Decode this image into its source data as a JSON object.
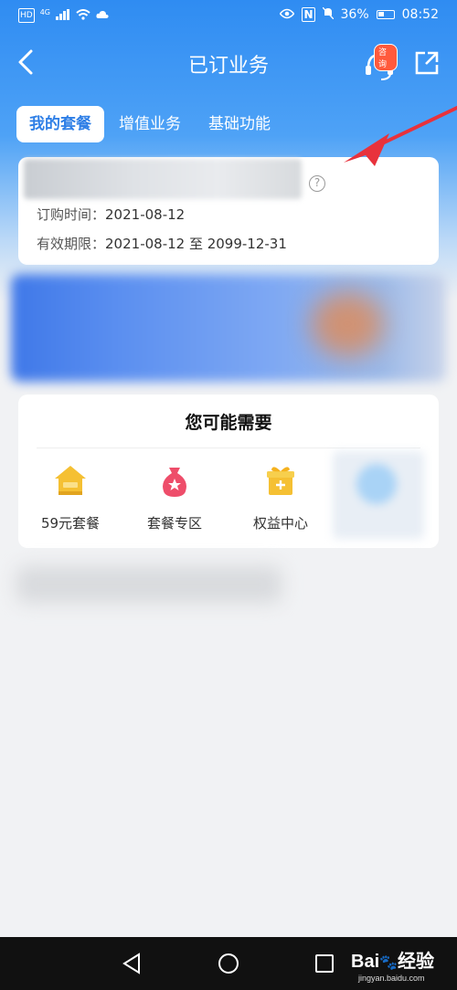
{
  "status_bar": {
    "network_left": "HD",
    "network_sup": "4G",
    "battery_percent": "36%",
    "time": "08:52",
    "battery_level": 0.36
  },
  "header": {
    "title": "已订业务",
    "service_badge": "咨询"
  },
  "tabs": [
    {
      "label": "我的套餐",
      "active": true
    },
    {
      "label": "增值业务",
      "active": false
    },
    {
      "label": "基础功能",
      "active": false
    }
  ],
  "package": {
    "order_time_label": "订购时间：",
    "order_time_value": "2021-08-12",
    "valid_label": "有效期限：",
    "valid_value": "2021-08-12 至 2099-12-31"
  },
  "need_section": {
    "title": "您可能需要",
    "items": [
      {
        "label": "59元套餐",
        "icon": "house-icon"
      },
      {
        "label": "套餐专区",
        "icon": "money-bag-icon"
      },
      {
        "label": "权益中心",
        "icon": "gift-box-icon"
      }
    ]
  },
  "watermark": {
    "brand": "Bai",
    "brand_cn": "经验",
    "url": "jingyan.baidu.com"
  },
  "colors": {
    "accent_blue": "#2f8cf2",
    "tab_active_text": "#2f7fe6",
    "annotation_red": "#e8323c"
  }
}
